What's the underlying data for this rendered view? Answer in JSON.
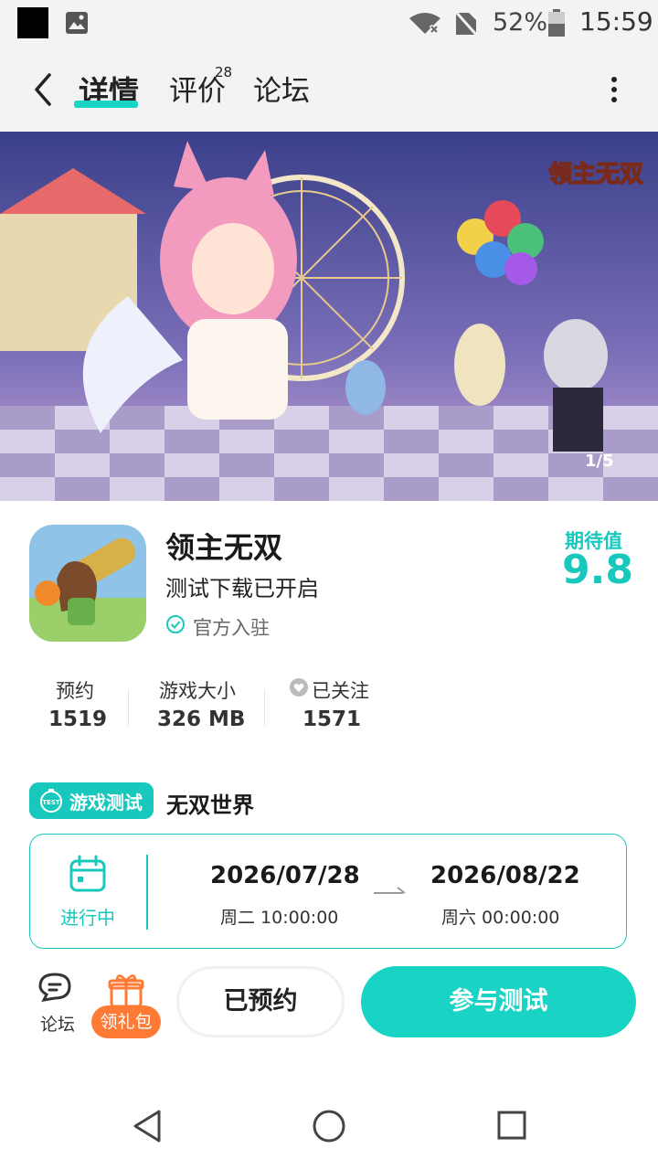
{
  "status_bar": {
    "battery_percent": "52%",
    "time": "15:59",
    "icons": [
      "notification-square-icon",
      "image-icon",
      "wifi-off-icon",
      "no-sim-icon",
      "battery-icon"
    ]
  },
  "nav": {
    "tabs": [
      {
        "label": "详情",
        "active": true
      },
      {
        "label": "评价",
        "count": "28"
      },
      {
        "label": "论坛"
      }
    ]
  },
  "banner": {
    "counter": "1/5",
    "logo_text": "领主无双"
  },
  "app": {
    "name": "领主无双",
    "subtitle": "测试下载已开启",
    "verified": "官方入驻",
    "expect_label": "期待值",
    "expect_value": "9.8"
  },
  "stats": [
    {
      "label": "预约",
      "value": "1519"
    },
    {
      "label": "游戏大小",
      "value": "326 MB"
    },
    {
      "label": "已关注",
      "value": "1571"
    }
  ],
  "test": {
    "badge": "游戏测试",
    "badge_icon_text": "TEST",
    "title": "无双世界",
    "status": "进行中",
    "start_date": "2026/07/28",
    "start_time": "周二  10:00:00",
    "end_date": "2026/08/22",
    "end_time": "周六  00:00:00"
  },
  "bottom_bar": {
    "forum_label": "论坛",
    "gift_label": "领礼包",
    "reserved_label": "已预约",
    "join_label": "参与测试"
  },
  "colors": {
    "accent": "#19d3c5",
    "gift": "#ff7a34"
  }
}
